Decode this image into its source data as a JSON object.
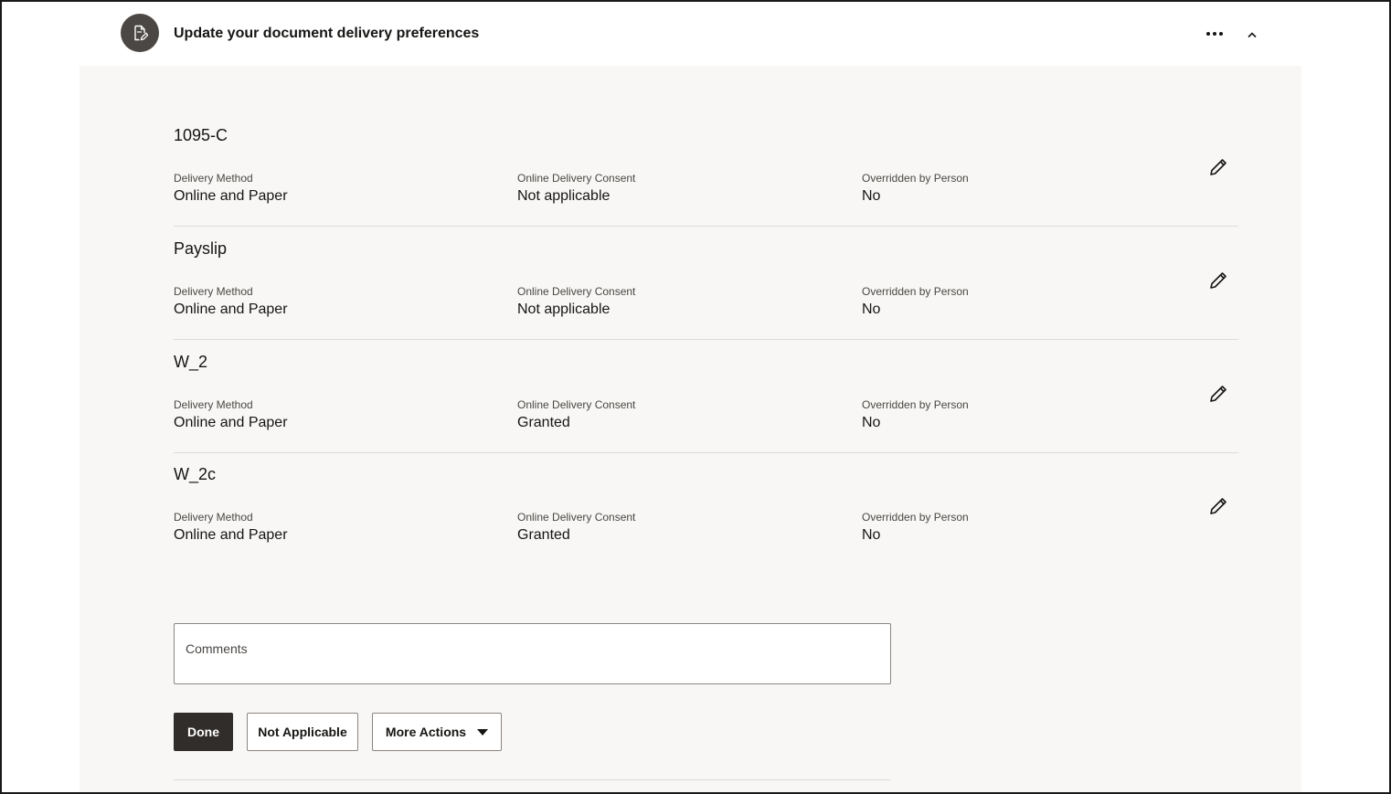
{
  "task": {
    "title": "Update your document delivery preferences",
    "avatar_icon": "document-edit-icon"
  },
  "header_actions": {
    "more_icon": "more-horizontal-icon",
    "collapse_icon": "chevron-up-icon"
  },
  "labels": {
    "delivery_method": "Delivery Method",
    "online_delivery_consent": "Online Delivery Consent",
    "overridden_by_person": "Overridden by Person"
  },
  "documents": [
    {
      "name": "1095-C",
      "delivery_method": "Online and Paper",
      "online_delivery_consent": "Not applicable",
      "overridden_by_person": "No"
    },
    {
      "name": "Payslip",
      "delivery_method": "Online and Paper",
      "online_delivery_consent": "Not applicable",
      "overridden_by_person": "No"
    },
    {
      "name": "W_2",
      "delivery_method": "Online and Paper",
      "online_delivery_consent": "Granted",
      "overridden_by_person": "No"
    },
    {
      "name": "W_2c",
      "delivery_method": "Online and Paper",
      "online_delivery_consent": "Granted",
      "overridden_by_person": "No"
    }
  ],
  "comments": {
    "label": "Comments",
    "value": ""
  },
  "actions": {
    "done": "Done",
    "not_applicable": "Not Applicable",
    "more_actions": "More Actions"
  },
  "colors": {
    "panel_bg": "#f8f7f5",
    "primary_button": "#312d2a",
    "avatar_bg": "#4a4744",
    "divider": "#dedbd7"
  }
}
